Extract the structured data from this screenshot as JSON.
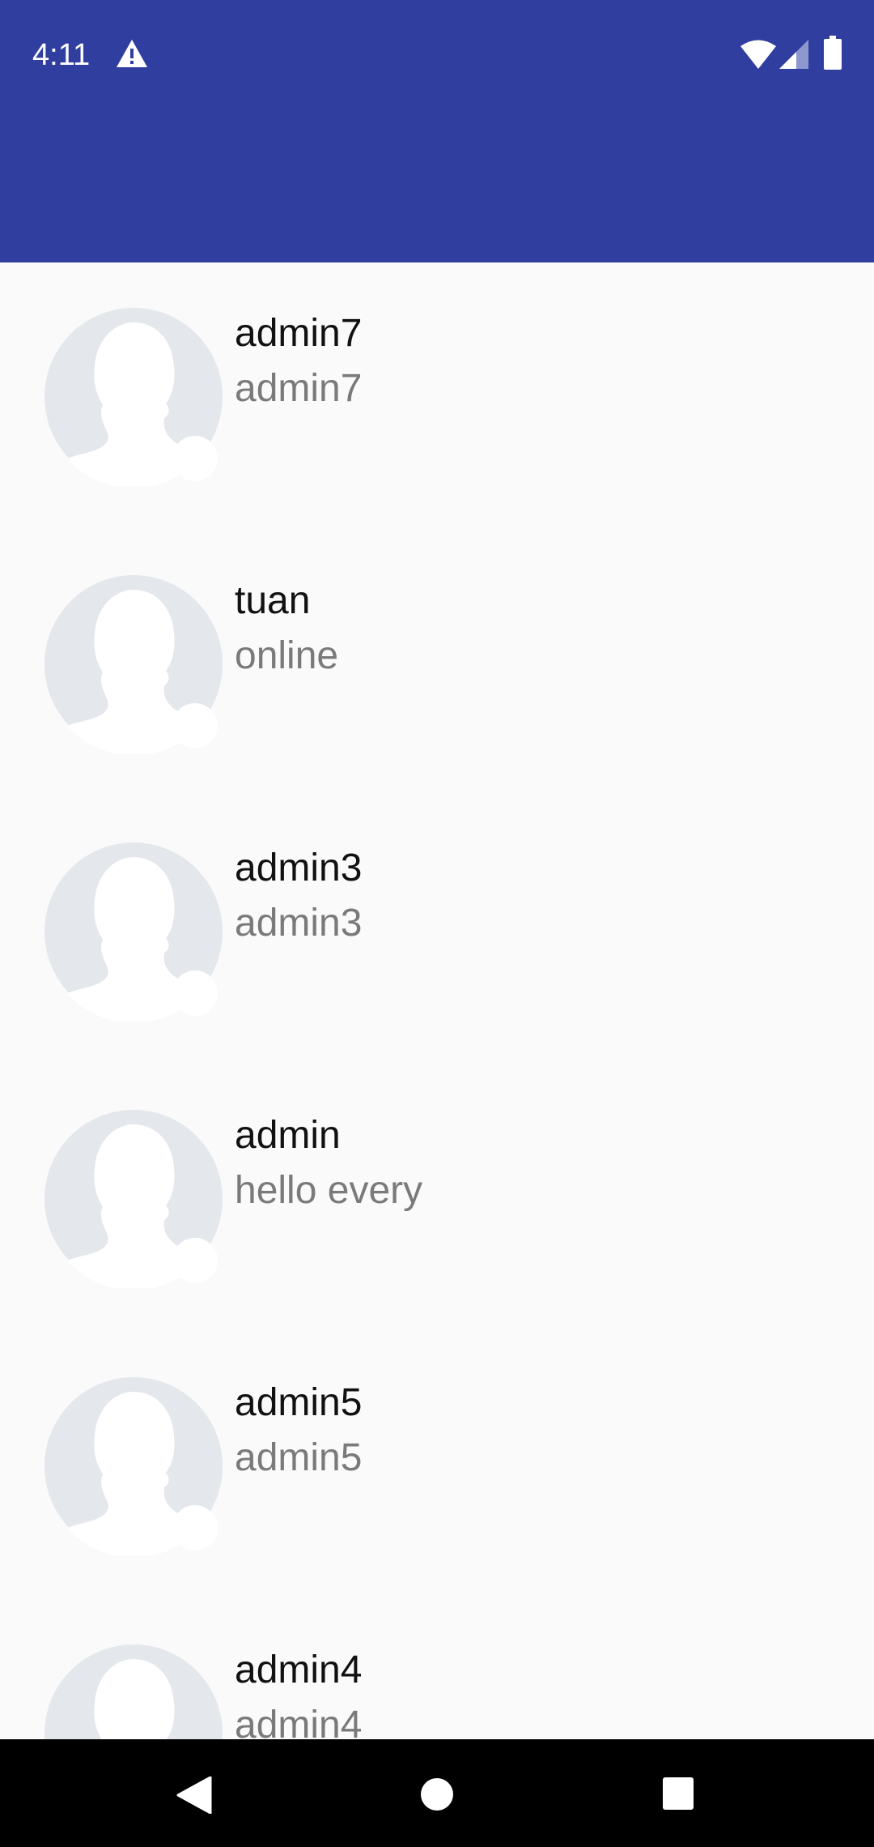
{
  "status_bar": {
    "time": "4:11",
    "icons": [
      "warning-icon",
      "wifi-icon",
      "cell-signal-icon",
      "battery-icon"
    ]
  },
  "app_bar": {
    "color": "#303f9f"
  },
  "contacts": [
    {
      "name": "admin7",
      "status": "admin7",
      "avatar": "default-avatar-icon"
    },
    {
      "name": "tuan",
      "status": "online",
      "avatar": "default-avatar-icon"
    },
    {
      "name": "admin3",
      "status": "admin3",
      "avatar": "default-avatar-icon"
    },
    {
      "name": "admin",
      "status": "hello every",
      "avatar": "default-avatar-icon"
    },
    {
      "name": "admin5",
      "status": "admin5",
      "avatar": "default-avatar-icon"
    },
    {
      "name": "admin4",
      "status": "admin4",
      "avatar": "default-avatar-icon"
    }
  ],
  "nav_bar": {
    "buttons": [
      "back-icon",
      "home-icon",
      "recents-icon"
    ]
  }
}
